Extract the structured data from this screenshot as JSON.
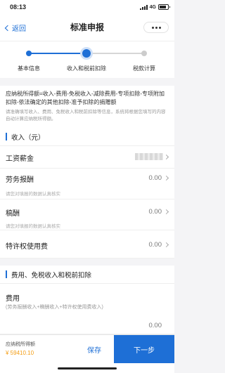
{
  "status": {
    "time": "08:13",
    "network": "4G"
  },
  "nav": {
    "back_label": "返回",
    "title": "标准申报"
  },
  "steps": [
    {
      "label": "基本信息"
    },
    {
      "label": "收入和税前扣除"
    },
    {
      "label": "税款计算"
    }
  ],
  "formula": {
    "main": "应纳税所得额=收入-费用-免税收入-减除费用-专项扣除-专项附加扣除-依法确定的其他扣除-准予扣除的捐赠额",
    "tip": "请准确填写收入、费用、免税收入和税前扣除等信息，系统将根据您填写的内容自动计算应纳税所得额。"
  },
  "income_section": {
    "title": "收入（元）",
    "wage": {
      "label": "工资薪金"
    },
    "labor": {
      "label": "劳务报酬",
      "value": "0.00",
      "hint": "请您对填报的数据认真核实"
    },
    "royalty": {
      "label": "稿酬",
      "value": "0.00",
      "hint": "请您对填报的数据认真核实"
    },
    "franchise": {
      "label": "特许权使用费",
      "value": "0.00"
    }
  },
  "deduction_section": {
    "title": "费用、免税收入和税前扣除",
    "expense": {
      "label": "费用",
      "sub": "(劳务报酬收入+稿酬收入+特许权使用费收入)",
      "value": "0.00"
    }
  },
  "bottom": {
    "taxable_label": "应纳税所得额",
    "taxable_value": "¥ 59410.10",
    "save_label": "保存",
    "next_label": "下一步"
  }
}
